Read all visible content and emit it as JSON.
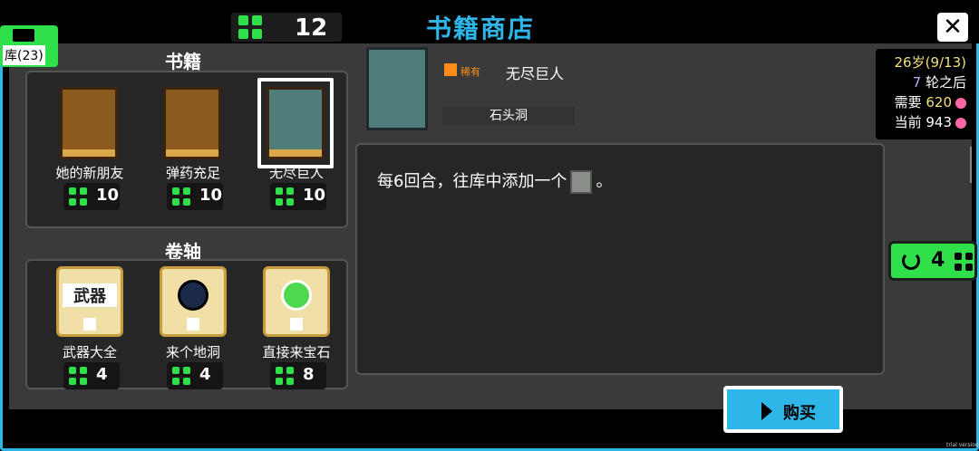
{
  "header": {
    "currency_value": "12",
    "title": "书籍商店",
    "close_icon": "close-icon"
  },
  "deck": {
    "label": "库(23)"
  },
  "books": {
    "title": "书籍",
    "items": [
      {
        "label": "她的新朋友",
        "price": "10"
      },
      {
        "label": "弹药充足",
        "price": "10"
      },
      {
        "label": "无尽巨人",
        "price": "10",
        "selected": true
      }
    ]
  },
  "scrolls": {
    "title": "卷轴",
    "items": [
      {
        "label": "武器大全",
        "price": "4",
        "art_text": "武器"
      },
      {
        "label": "来个地洞",
        "price": "4"
      },
      {
        "label": "直接来宝石",
        "price": "8"
      }
    ]
  },
  "detail": {
    "rarity": "稀有",
    "name": "无尽巨人",
    "tag": "石头洞",
    "description_before": "每6回合，往库中添加一个",
    "description_after": "。"
  },
  "info": {
    "age": "26岁(9/13)",
    "rounds_num": "7",
    "rounds_text": "轮之后",
    "need_label": "需要",
    "need_value": "620",
    "current_label": "当前",
    "current_value": "943"
  },
  "refresh": {
    "value": "4"
  },
  "buy": {
    "label": "购买"
  },
  "watermark": "trial version",
  "colors": {
    "accent": "#2fb6e8",
    "clover": "#2fe04a",
    "rarity": "#ff8c1a"
  }
}
